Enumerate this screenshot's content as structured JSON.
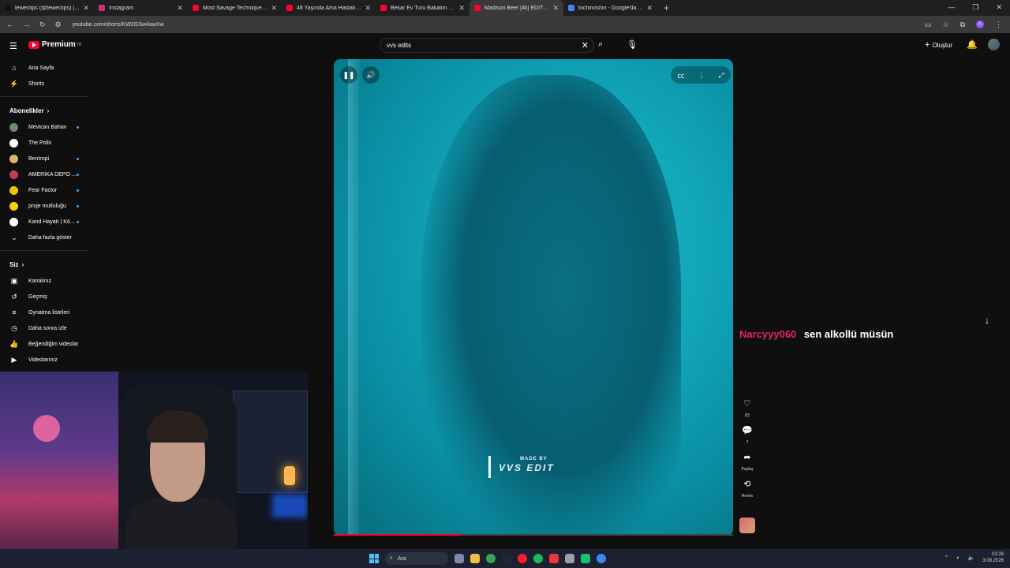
{
  "browser": {
    "tabs": [
      {
        "title": "teweclips (@teweclips) | TikTok",
        "color": "#111111"
      },
      {
        "title": "Instagram",
        "color": "#d62976"
      },
      {
        "title": "Most Savage Technique in Sumo",
        "color": "#ff0033"
      },
      {
        "title": "48 Yaşında Ama Hastalığı Yüzünden",
        "color": "#ff0033"
      },
      {
        "title": "Bekar Ev Turu Bakalım Beğenecek",
        "color": "#ff0033"
      },
      {
        "title": "Madison Beer [4k] EDIT || w...",
        "color": "#ff0033"
      },
      {
        "title": "tochinoshin - Google'da Ara",
        "color": "#4285f4"
      }
    ],
    "active_tab_index": 5,
    "url": "youtube.com/shorts/KW2GSw4awXw",
    "profile_initial": "K"
  },
  "youtube": {
    "logo_text": "Premium",
    "logo_sup": "TR",
    "search_value": "vvs edits",
    "create_label": "Oluştur"
  },
  "sidebar": {
    "main": [
      {
        "label": "Ana Sayfa",
        "icon": "home-icon",
        "glyph": "⌂"
      },
      {
        "label": "Shorts",
        "icon": "shorts-icon",
        "glyph": "⚡"
      }
    ],
    "subs_title": "Abonelikler",
    "subscriptions": [
      {
        "label": "Mevtcan Bahav",
        "color": "#6b8b6b",
        "dot": true
      },
      {
        "label": "The Polis",
        "color": "#ffffff",
        "dot": false
      },
      {
        "label": "Bentropi",
        "color": "#e0b36a",
        "dot": true
      },
      {
        "label": "AMERİKA DEPO ...",
        "color": "#c0405a",
        "dot": true
      },
      {
        "label": "Fear Factor",
        "color": "#f2c200",
        "dot": true
      },
      {
        "label": "proje mutluluğu",
        "color": "#f5d400",
        "dot": true
      },
      {
        "label": "Kand Hayatı | Kö...",
        "color": "#ffffff",
        "dot": true
      }
    ],
    "more_label": "Daha fazla göster",
    "you_title": "Siz",
    "you_items": [
      {
        "label": "Kanalınız",
        "icon": "channel-icon",
        "glyph": "▣"
      },
      {
        "label": "Geçmiş",
        "icon": "history-icon",
        "glyph": "↺"
      },
      {
        "label": "Oynatma listeleri",
        "icon": "playlists-icon",
        "glyph": "≡"
      },
      {
        "label": "Daha sonra izle",
        "icon": "watch-later-icon",
        "glyph": "◷"
      },
      {
        "label": "Beğendiğim videolar",
        "icon": "liked-icon",
        "glyph": "👍"
      },
      {
        "label": "Videolarınız",
        "icon": "your-videos-icon",
        "glyph": "▶"
      }
    ]
  },
  "video": {
    "watermark_made_by": "MADE BY",
    "watermark_brand": "VVS EDIT",
    "progress_fraction": 0.32
  },
  "actions": {
    "likes": "83",
    "comments": "7",
    "share": "Paylaş",
    "remix": "Remix"
  },
  "overlay_comment": {
    "user": "Narcyyy060",
    "text": "sen alkollü müsün"
  },
  "taskbar": {
    "search_label": "Ara",
    "time": "03:28",
    "date": "3.08.2026"
  }
}
